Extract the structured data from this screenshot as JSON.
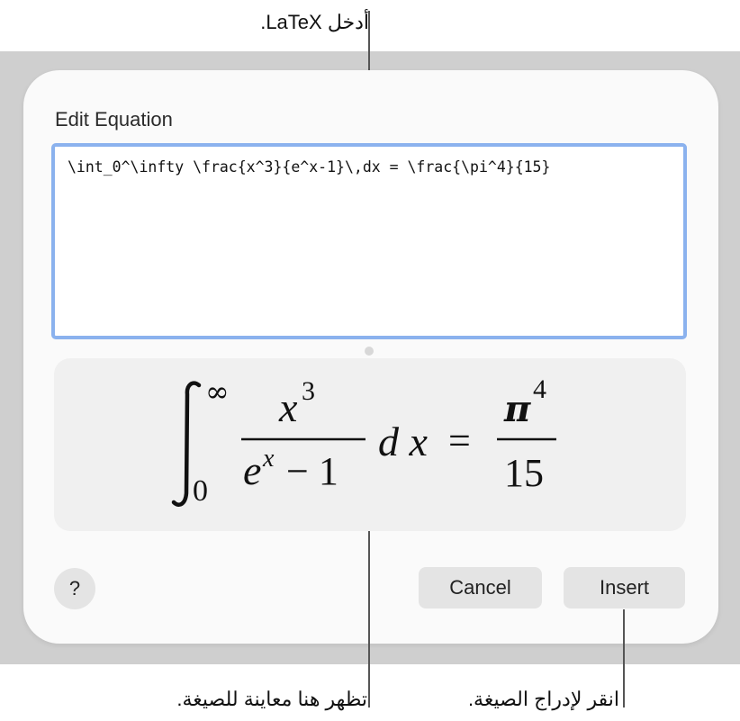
{
  "callouts": {
    "latex": "أدخل LaTeX.",
    "preview": "تظهر هنا معاينة للصيغة.",
    "insert": "انقر لإدراج الصيغة."
  },
  "dialog": {
    "title": "Edit Equation",
    "latex_input": "\\int_0^\\infty \\frac{x^3}{e^x-1}\\,dx = \\frac{\\pi^4}{15}",
    "preview": {
      "integral_upper": "∞",
      "integral_lower": "0",
      "numerator_base": "x",
      "numerator_exp": "3",
      "denominator_base": "e",
      "denominator_exp": "x",
      "denominator_rest": "− 1",
      "differential": "d x",
      "equals": "=",
      "rhs_numerator_base": "π",
      "rhs_numerator_exp": "4",
      "rhs_denominator": "15"
    },
    "help_label": "?",
    "cancel_label": "Cancel",
    "insert_label": "Insert"
  }
}
